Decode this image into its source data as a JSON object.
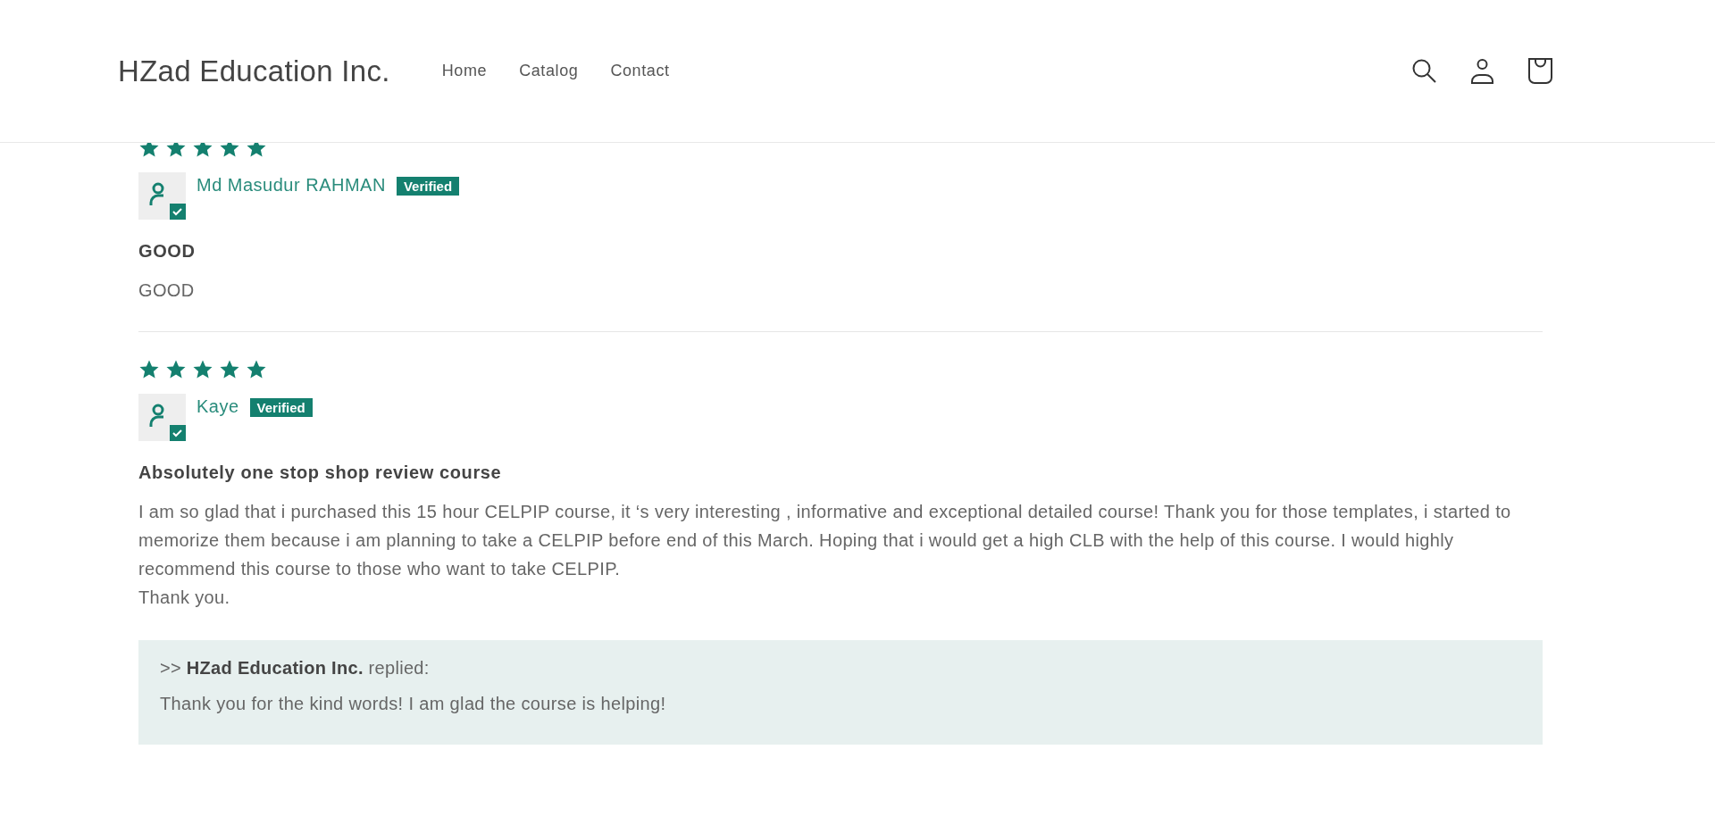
{
  "header": {
    "logo": "HZad Education Inc.",
    "nav": [
      {
        "label": "Home"
      },
      {
        "label": "Catalog"
      },
      {
        "label": "Contact"
      }
    ]
  },
  "reviews": [
    {
      "stars": 5,
      "author": "Md Masudur RAHMAN",
      "badge": "Verified",
      "title": "GOOD",
      "body": [
        "GOOD"
      ]
    },
    {
      "stars": 5,
      "author": "Kaye",
      "badge": "Verified",
      "title": "Absolutely one stop shop review course",
      "body": [
        "I am so glad that i purchased this 15 hour CELPIP course, it ‘s very interesting , informative and exceptional detailed course! Thank you for those templates, i started to memorize them because i am planning to take a CELPIP before end of this March. Hoping that i would get a high CLB with the help of this course. I would highly recommend this course to those who want to take CELPIP.",
        "Thank you."
      ],
      "reply": {
        "heading": ">> **HZad Education Inc.** replied:",
        "text": "Thank you for the kind words! I am glad the course is helping!"
      }
    }
  ]
}
